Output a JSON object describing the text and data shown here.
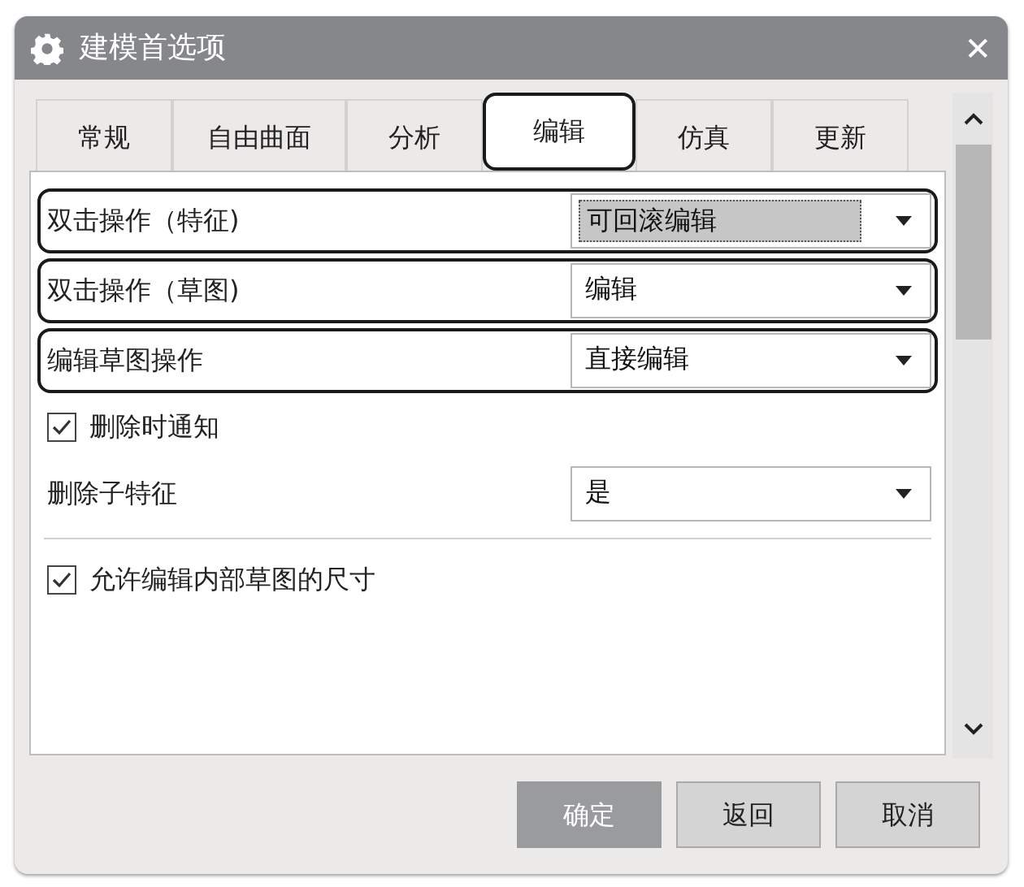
{
  "window": {
    "title": "建模首选项",
    "close": "✕"
  },
  "tabs": [
    {
      "label": "常规",
      "selected": false
    },
    {
      "label": "自由曲面",
      "selected": false
    },
    {
      "label": "分析",
      "selected": false
    },
    {
      "label": "编辑",
      "selected": true
    },
    {
      "label": "仿真",
      "selected": false
    },
    {
      "label": "更新",
      "selected": false
    }
  ],
  "rows": [
    {
      "kind": "dropdown",
      "label": "双击操作（特征)",
      "value": "可回滚编辑",
      "focused": true,
      "highlighted": true
    },
    {
      "kind": "dropdown",
      "label": "双击操作（草图)",
      "value": "编辑",
      "focused": false,
      "highlighted": true
    },
    {
      "kind": "dropdown",
      "label": "编辑草图操作",
      "value": "直接编辑",
      "focused": false,
      "highlighted": true
    },
    {
      "kind": "checkbox",
      "label": "删除时通知",
      "checked": true
    },
    {
      "kind": "dropdown",
      "label": "删除子特征",
      "value": "是",
      "focused": false,
      "highlighted": false
    },
    {
      "kind": "divider"
    },
    {
      "kind": "checkbox",
      "label": "允许编辑内部草图的尺寸",
      "checked": true
    }
  ],
  "buttons": [
    {
      "label": "确定",
      "disabled": true
    },
    {
      "label": "返回",
      "disabled": false
    },
    {
      "label": "取消",
      "disabled": false
    }
  ]
}
